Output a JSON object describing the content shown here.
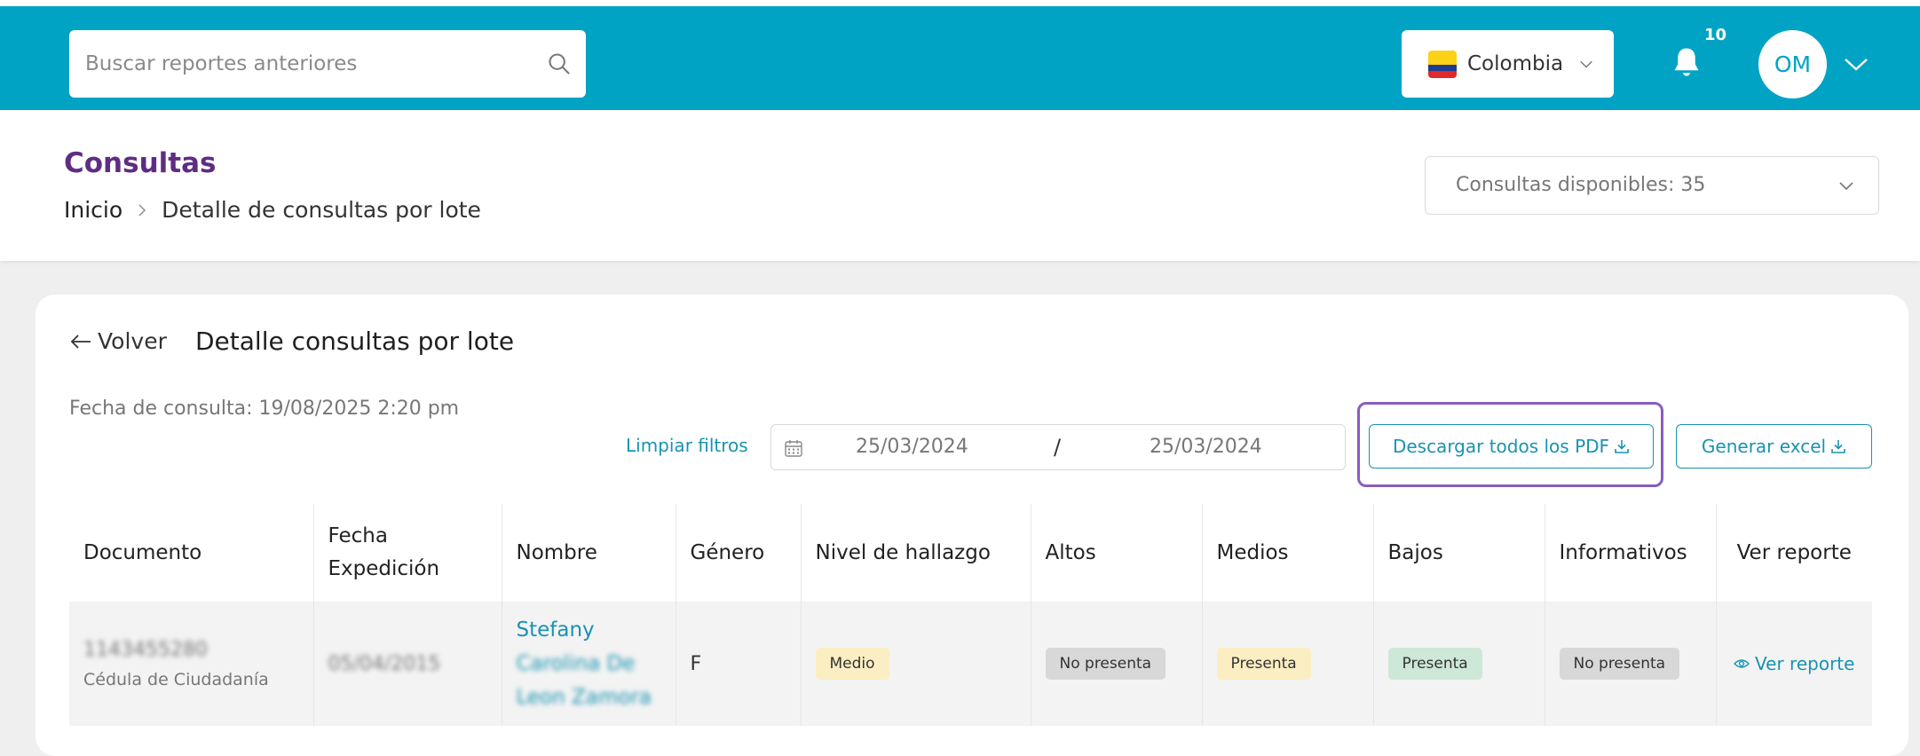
{
  "topbar": {
    "search_placeholder": "Buscar reportes anteriores",
    "country": "Colombia",
    "notification_count": "10",
    "user_initials": "OM",
    "color": "#00a3c4"
  },
  "header": {
    "title": "Consultas",
    "breadcrumb_home": "Inicio",
    "breadcrumb_current": "Detalle de consultas por lote",
    "available": "Consultas disponibles: 35"
  },
  "card": {
    "back_label": "Volver",
    "title": "Detalle consultas por lote",
    "consult_date": "Fecha de consulta: 19/08/2025 2:20 pm",
    "clear_filters": "Limpiar filtros",
    "date_from": "25/03/2024",
    "date_separator": "/",
    "date_to": "25/03/2024",
    "download_pdf": "Descargar todos los PDF",
    "generate_excel": "Generar excel"
  },
  "table": {
    "headers": [
      "Documento",
      "Fecha Expedición",
      "Nombre",
      "Género",
      "Nivel de hallazgo",
      "Altos",
      "Medios",
      "Bajos",
      "Informativos",
      "Ver reporte"
    ],
    "rows": [
      {
        "doc_number": "1143455280",
        "doc_type": "Cédula de Ciudadanía",
        "issue_date": "05/04/2015",
        "name_first": "Stefany",
        "name_line2": "Carolina De",
        "name_line3": "Leon Zamora",
        "gender": "F",
        "level": "Medio",
        "altos": "No presenta",
        "medios": "Presenta",
        "bajos": "Presenta",
        "informativos": "No presenta",
        "view": "Ver reporte"
      }
    ]
  },
  "colors": {
    "accent": "#00a3c4",
    "link": "#1993b2",
    "title_purple": "#5e2d83",
    "highlight": "#8a5cc1"
  }
}
